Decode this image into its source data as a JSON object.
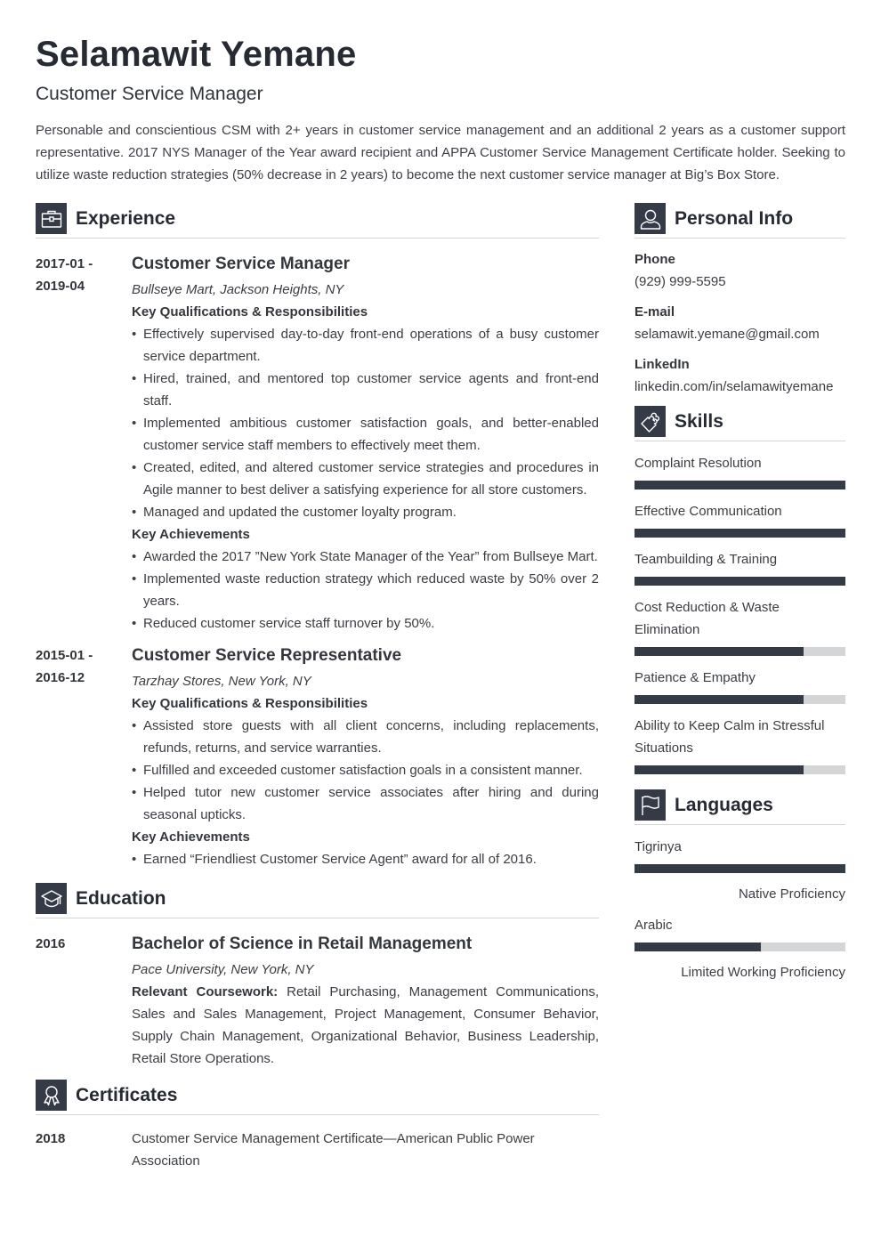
{
  "header": {
    "name": "Selamawit Yemane",
    "title": "Customer Service Manager",
    "summary": "Personable and conscientious CSM with 2+ years in customer service management and an additional 2 years as a customer support representative. 2017 NYS Manager of the Year award recipient and APPA Customer Service Management Certificate holder. Seeking to utilize waste reduction strategies (50% decrease in 2 years) to become the next customer service manager at Big’s Box Store."
  },
  "experience": {
    "heading": "Experience",
    "icon": "briefcase-icon",
    "jobs": [
      {
        "date_start": "2017-01 -",
        "date_end": "2019-04",
        "title": "Customer Service Manager",
        "org": "Bullseye Mart, Jackson Heights, NY",
        "qual_heading": "Key Qualifications & Responsibilities",
        "qualifications": [
          "Effectively supervised day-to-day front-end operations of a busy customer service department.",
          "Hired, trained, and mentored top customer service agents and front-end staff.",
          "Implemented ambitious customer satisfaction goals, and better-enabled customer service staff members to effectively meet them.",
          "Created, edited, and altered customer service strategies and procedures in Agile manner to best deliver a satisfying experience for all store customers.",
          "Managed and updated the customer loyalty program."
        ],
        "ach_heading": "Key Achievements",
        "achievements": [
          "Awarded the 2017 ”New York State Manager of the Year” from Bullseye Mart.",
          "Implemented waste reduction strategy which reduced waste by 50% over 2 years.",
          "Reduced customer service staff turnover by 50%."
        ]
      },
      {
        "date_start": "2015-01 -",
        "date_end": "2016-12",
        "title": "Customer Service Representative",
        "org": "Tarzhay Stores, New York, NY",
        "qual_heading": "Key Qualifications & Responsibilities",
        "qualifications": [
          "Assisted store guests with all client concerns, including replacements, refunds, returns, and service warranties.",
          "Fulfilled and exceeded customer satisfaction goals in a consistent manner.",
          "Helped tutor new customer service associates after hiring and during seasonal upticks."
        ],
        "ach_heading": "Key Achievements",
        "achievements": [
          "Earned “Friendliest Customer Service Agent” award for all of 2016."
        ]
      }
    ]
  },
  "education": {
    "heading": "Education",
    "icon": "graduation-cap-icon",
    "items": [
      {
        "date": "2016",
        "degree": "Bachelor of Science in Retail Management",
        "school": "Pace University, New York, NY",
        "coursework_label": "Relevant Coursework:",
        "coursework": " Retail Purchasing, Management Communications, Sales and Sales Management, Project Management, Consumer Behavior, Supply Chain Management, Organizational Behavior, Business Leadership, Retail Store Operations."
      }
    ]
  },
  "certificates": {
    "heading": "Certificates",
    "icon": "award-ribbon-icon",
    "items": [
      {
        "date": "2018",
        "text": "Customer Service Management Certificate—American Public Power Association"
      }
    ]
  },
  "personal": {
    "heading": "Personal Info",
    "icon": "user-icon",
    "fields": [
      {
        "label": "Phone",
        "value": "(929) 999-5595"
      },
      {
        "label": "E-mail",
        "value": "selamawit.yemane@gmail.com"
      },
      {
        "label": "LinkedIn",
        "value": "linkedin.com/in/selamawityemane"
      }
    ]
  },
  "skills": {
    "heading": "Skills",
    "icon": "puzzle-piece-icon",
    "items": [
      {
        "name": "Complaint Resolution",
        "level": 1.0
      },
      {
        "name": "Effective Communication",
        "level": 1.0
      },
      {
        "name": "Teambuilding & Training",
        "level": 1.0
      },
      {
        "name": "Cost Reduction & Waste Elimination",
        "level": 0.8
      },
      {
        "name": "Patience & Empathy",
        "level": 0.8
      },
      {
        "name": "Ability to Keep Calm in Stressful Situations",
        "level": 0.8
      }
    ]
  },
  "languages": {
    "heading": "Languages",
    "icon": "flag-icon",
    "items": [
      {
        "name": "Tigrinya",
        "level": 1.0,
        "proficiency": "Native Proficiency"
      },
      {
        "name": "Arabic",
        "level": 0.6,
        "proficiency": "Limited Working Proficiency"
      }
    ]
  }
}
